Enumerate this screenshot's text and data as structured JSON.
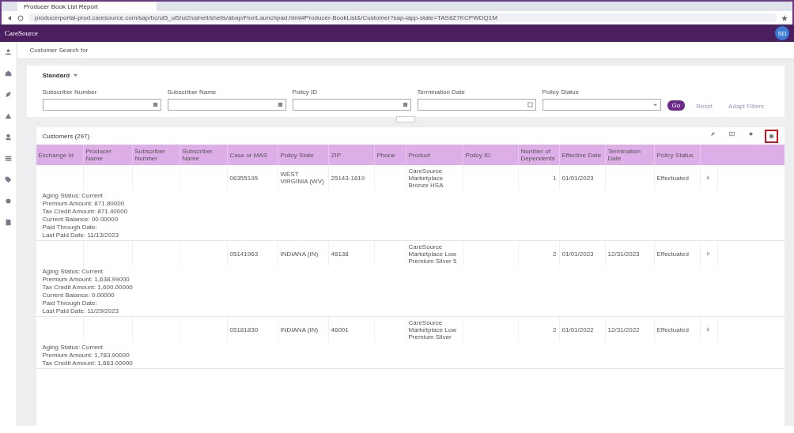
{
  "browser": {
    "tab_title": "Producer Book List Report",
    "url": "producerportal-prod.caresource.com/sap/bc/ui5_ui5/ui2/ushell/shells/abap/FioriLaunchpad.html#Producer-BookList&/Customer?sap-iapp-state=TAS8Z7KCPWDQ1M"
  },
  "app_bar": {
    "logo": "CareSource",
    "avatar": "SD"
  },
  "breadcrumb": "Customer Search for",
  "filter": {
    "variant": "Standard",
    "fields": [
      {
        "label": "Subscriber Number",
        "kind": "value-help"
      },
      {
        "label": "Subscriber Name",
        "kind": "value-help"
      },
      {
        "label": "Policy ID",
        "kind": "value-help"
      },
      {
        "label": "Termination Date",
        "kind": "date"
      },
      {
        "label": "Policy Status",
        "kind": "select"
      }
    ],
    "go": "Go",
    "reset": "Reset",
    "adapt": "Adapt Filters"
  },
  "table": {
    "title": "Customers (297)",
    "tools": [
      {
        "kind": "edit",
        "highlighted": false
      },
      {
        "kind": "grid",
        "highlighted": false
      },
      {
        "kind": "settings",
        "highlighted": false
      },
      {
        "kind": "export",
        "highlighted": true
      }
    ],
    "columns": [
      "Exchange Id",
      "Producer Name",
      "Subscriber Number",
      "Subscriber Name",
      "Case or MAS",
      "Policy State",
      "ZIP",
      "Phone",
      "Product",
      "Policy ID",
      "Number of Dependents",
      "Effective Date",
      "Termination Date",
      "Policy Status"
    ],
    "rows": [
      {
        "cells": [
          "",
          "",
          "",
          "",
          "06355195",
          "WEST VIRGINIA (WV)",
          "25143-1619",
          "",
          "CareSource Marketplace Bronze HSA",
          "",
          "1",
          "01/01/2023",
          "",
          "Effectuated"
        ],
        "details": [
          "Aging Status: Current",
          "Premium Amount: 871.80000",
          "Tax Credit Amount: 871.40000",
          "Current Balance: 00.00000",
          "Paid Through Date:",
          "Last Paid Date: 11/13/2023"
        ]
      },
      {
        "cells": [
          "",
          "",
          "",
          "",
          "05141963",
          "INDIANA (IN)",
          "46138",
          "",
          "CareSource Marketplace Low Premium Silver 5",
          "",
          "2",
          "01/01/2023",
          "12/31/2023",
          "Effectuated"
        ],
        "details": [
          "Aging Status: Current",
          "Premium Amount: 1,638.99000",
          "Tax Credit Amount: 1,600.00000",
          "Current Balance: 0.00000",
          "Paid Through Date:",
          "Last Paid Date: 11/29/2023"
        ]
      },
      {
        "cells": [
          "",
          "",
          "",
          "",
          "05181830",
          "INDIANA (IN)",
          "46001",
          "",
          "CareSource Marketplace Low Premium Silver",
          "",
          "2",
          "01/01/2022",
          "12/31/2022",
          "Effectuated"
        ],
        "details": [
          "Aging Status: Current",
          "Premium Amount: 1,783.90000",
          "Tax Credit Amount: 1,663.00000"
        ]
      }
    ]
  }
}
